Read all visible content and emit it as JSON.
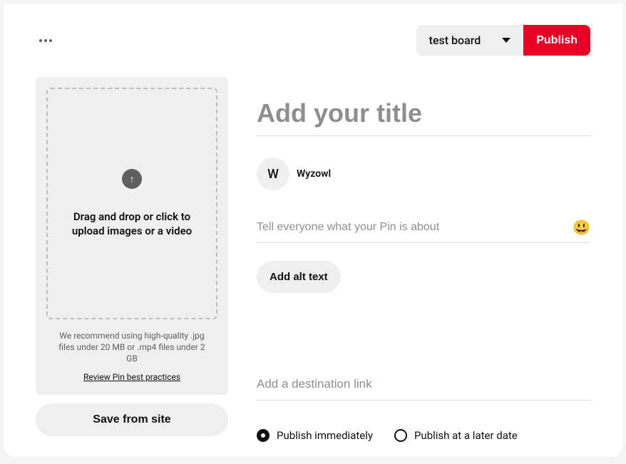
{
  "topbar": {
    "board_selected": "test board",
    "publish_label": "Publish"
  },
  "upload": {
    "drop_text": "Drag and drop or click to upload images or a video",
    "recommend_text": "We recommend using high-quality .jpg files under 20 MB or .mp4 files under 2 GB",
    "review_link": "Review Pin best practices",
    "save_from_site_label": "Save from site"
  },
  "form": {
    "title_placeholder": "Add your title",
    "avatar_initial": "W",
    "username": "Wyzowl",
    "description_placeholder": "Tell everyone what your Pin is about",
    "alt_text_label": "Add alt text",
    "link_placeholder": "Add a destination link"
  },
  "schedule": {
    "immediate_label": "Publish immediately",
    "later_label": "Publish at a later date"
  }
}
